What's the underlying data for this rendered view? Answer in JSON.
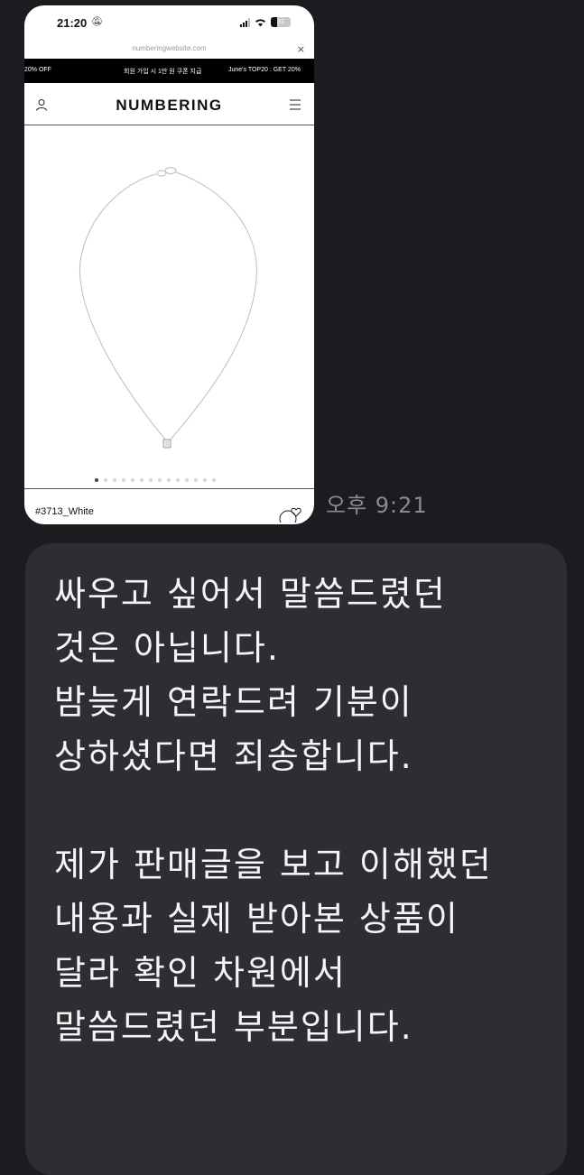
{
  "screenshot": {
    "status_bar": {
      "time": "21:20",
      "battery_level": "31"
    },
    "browser": {
      "url": "numberingwebsite.com",
      "close": "×"
    },
    "promo": [
      "20% OFF",
      "회원 가입 시 1만 원 쿠폰 지급",
      "June's TOP20 : GET 20%"
    ],
    "header": {
      "brand": "NUMBERING"
    },
    "gallery": {
      "slide_count": 14,
      "current_slide": 1
    },
    "product": {
      "name": "#3713_White"
    }
  },
  "message_meta": {
    "time": "오후 9:21"
  },
  "message": {
    "text": "싸우고 싶어서 말씀드렸던\n것은 아닙니다.\n밤늦게 연락드려 기분이\n상하셨다면 죄송합니다.\n\n제가 판매글을 보고 이해했던\n내용과 실제 받아본 상품이\n달라 확인 차원에서\n말씀드렸던 부분입니다."
  },
  "colors": {
    "background": "#1b1c1f",
    "bubble": "#2d2e33",
    "text": "#f5f5f5",
    "time": "#8a8b8e"
  }
}
